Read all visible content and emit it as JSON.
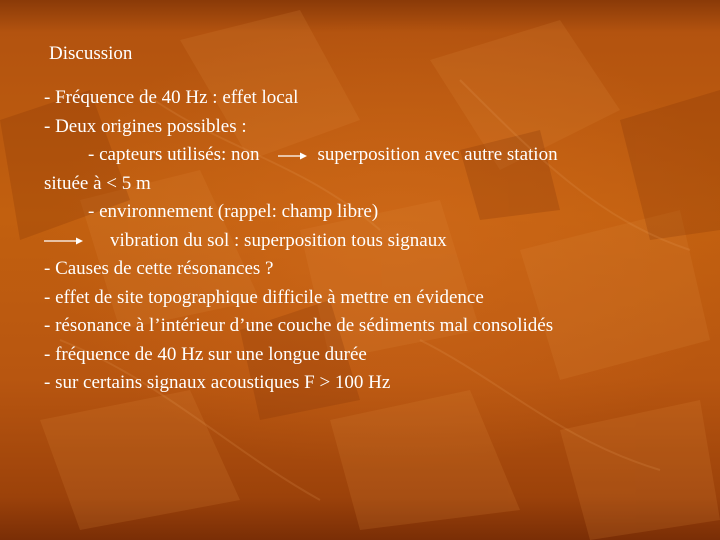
{
  "slide": {
    "title": "Discussion",
    "lines": {
      "l1": "- Fréquence de 40 Hz : effet local",
      "l2": "- Deux origines possibles :",
      "l3a": "- capteurs utilisés: non",
      "l3b": "superposition avec autre station",
      "l4": "située à  < 5 m",
      "l5": "- environnement (rappel: champ libre)",
      "l6": "vibration du sol : superposition tous signaux",
      "l7": "- Causes de cette résonances ?",
      "l8": "- effet de site topographique difficile à mettre en évidence",
      "l9": "- résonance à l’intérieur d’une couche de sédiments mal consolidés",
      "l10": "- fréquence de 40 Hz sur une longue durée",
      "l11": "- sur certains signaux acoustiques F > 100 Hz"
    },
    "icons": [
      "right-arrow-icon",
      "right-arrow-icon"
    ],
    "colors": {
      "text": "#ffffff",
      "background": "#b3530f"
    }
  }
}
